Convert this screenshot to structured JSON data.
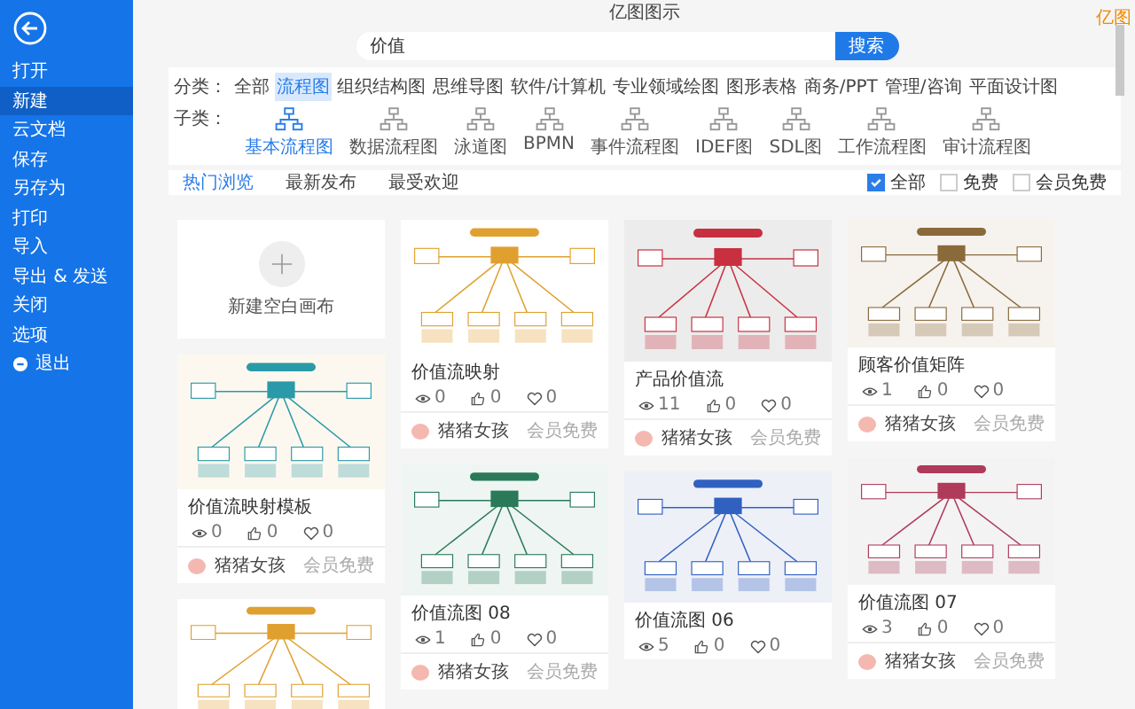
{
  "window": {
    "title": "亿图图示",
    "badge": "亿图"
  },
  "sidebar": {
    "items": [
      {
        "label": "打开",
        "selected": false,
        "kind": "plain"
      },
      {
        "label": "新建",
        "selected": true,
        "kind": "plain"
      },
      {
        "label": "云文档",
        "selected": false,
        "kind": "plain"
      },
      {
        "label": "保存",
        "selected": false,
        "kind": "plain"
      },
      {
        "label": "另存为",
        "selected": false,
        "kind": "plain"
      },
      {
        "label": "打印",
        "selected": false,
        "kind": "plain"
      },
      {
        "label": "导入",
        "selected": false,
        "kind": "plain"
      },
      {
        "label": "导出 & 发送",
        "selected": false,
        "kind": "plain"
      },
      {
        "label": "关闭",
        "selected": false,
        "kind": "plain"
      },
      {
        "label": "选项",
        "selected": false,
        "kind": "plain"
      },
      {
        "label": "退出",
        "selected": false,
        "kind": "exit"
      }
    ]
  },
  "search": {
    "value": "价值",
    "button": "搜索"
  },
  "categories": {
    "label": "分类：",
    "items": [
      {
        "label": "全部",
        "selected": false
      },
      {
        "label": "流程图",
        "selected": true
      },
      {
        "label": "组织结构图",
        "selected": false
      },
      {
        "label": "思维导图",
        "selected": false
      },
      {
        "label": "软件/计算机",
        "selected": false
      },
      {
        "label": "专业领域绘图",
        "selected": false
      },
      {
        "label": "图形表格",
        "selected": false
      },
      {
        "label": "商务/PPT",
        "selected": false
      },
      {
        "label": "管理/咨询",
        "selected": false
      },
      {
        "label": "平面设计图",
        "selected": false
      }
    ]
  },
  "subtypes": {
    "label": "子类：",
    "items": [
      {
        "label": "基本流程图",
        "selected": true
      },
      {
        "label": "数据流程图",
        "selected": false
      },
      {
        "label": "泳道图",
        "selected": false
      },
      {
        "label": "BPMN",
        "selected": false
      },
      {
        "label": "事件流程图",
        "selected": false
      },
      {
        "label": "IDEF图",
        "selected": false
      },
      {
        "label": "SDL图",
        "selected": false
      },
      {
        "label": "工作流程图",
        "selected": false
      },
      {
        "label": "审计流程图",
        "selected": false
      }
    ]
  },
  "sort_tabs": [
    {
      "label": "热门浏览",
      "selected": true
    },
    {
      "label": "最新发布",
      "selected": false
    },
    {
      "label": "最受欢迎",
      "selected": false
    }
  ],
  "filters": [
    {
      "label": "全部",
      "checked": true
    },
    {
      "label": "免费",
      "checked": false
    },
    {
      "label": "会员免费",
      "checked": false
    }
  ],
  "columns": [
    [
      {
        "kind": "blank",
        "label": "新建空白画布"
      },
      {
        "kind": "template",
        "title": "价值流映射模板",
        "views": "0",
        "likes": "0",
        "favorites": "0",
        "author": "猪猪女孩",
        "access": "会员免费"
      },
      {
        "kind": "template"
      }
    ],
    [
      {
        "kind": "template",
        "title": "价值流映射",
        "views": "0",
        "likes": "0",
        "favorites": "0",
        "author": "猪猪女孩",
        "access": "会员免费"
      },
      {
        "kind": "template",
        "title": "价值流图 08",
        "views": "1",
        "likes": "0",
        "favorites": "0",
        "author": "猪猪女孩",
        "access": "会员免费"
      }
    ],
    [
      {
        "kind": "template",
        "title": "产品价值流",
        "views": "11",
        "likes": "0",
        "favorites": "0",
        "author": "猪猪女孩",
        "access": "会员免费"
      },
      {
        "kind": "template",
        "title": "价值流图 06",
        "views": "5",
        "likes": "0",
        "favorites": "0"
      }
    ],
    [
      {
        "kind": "template",
        "title": "顾客价值矩阵",
        "views": "1",
        "likes": "0",
        "favorites": "0",
        "author": "猪猪女孩",
        "access": "会员免费"
      },
      {
        "kind": "template",
        "title": "价值流图 07",
        "views": "3",
        "likes": "0",
        "favorites": "0",
        "author": "猪猪女孩",
        "access": "会员免费"
      }
    ]
  ]
}
